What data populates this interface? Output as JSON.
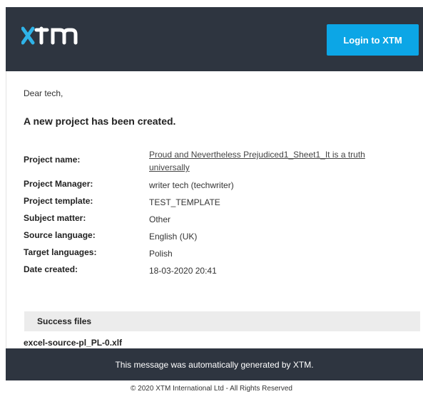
{
  "header": {
    "logo_text": "xtm",
    "login_button": "Login to XTM"
  },
  "email": {
    "greeting": "Dear tech,",
    "headline": "A new project has been created.",
    "details": [
      {
        "label": "Project name:",
        "value": "Proud and Nevertheless Prejudiced1_Sheet1_It is a truth universally"
      },
      {
        "label": "Project Manager:",
        "value": "writer tech (techwriter)"
      },
      {
        "label": "Project template:",
        "value": "TEST_TEMPLATE"
      },
      {
        "label": "Subject matter:",
        "value": "Other"
      },
      {
        "label": "Source language:",
        "value": "English (UK)"
      },
      {
        "label": "Target languages:",
        "value": "Polish"
      },
      {
        "label": "Date created:",
        "value": "18-03-2020 20:41"
      }
    ],
    "success_files_label": "Success files",
    "success_file": "excel-source-pl_PL-0.xlf"
  },
  "footer": {
    "message": "This message was automatically generated by XTM."
  },
  "copyright": "© 2020 XTM International Ltd - All Rights Reserved",
  "colors": {
    "header_bg": "#2e3540",
    "accent": "#0ca6e6",
    "logo_x": "#2fb3e8"
  }
}
